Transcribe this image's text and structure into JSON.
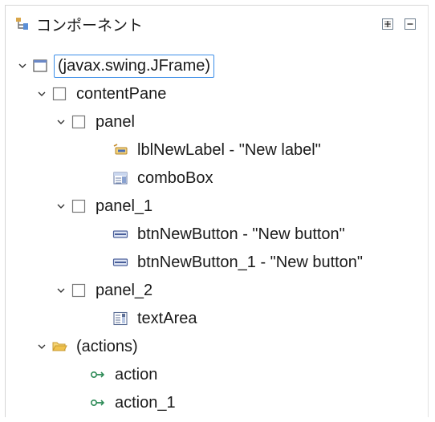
{
  "header": {
    "title": "コンポーネント",
    "icon": "component-tree-icon",
    "expand_all_icon": "expand-all-icon",
    "collapse_all_icon": "collapse-all-icon"
  },
  "tree": {
    "root": {
      "label": "(javax.swing.JFrame)",
      "selected": true
    },
    "contentPane": {
      "label": "contentPane"
    },
    "panel": {
      "label": "panel"
    },
    "lblNewLabel": {
      "label": "lblNewLabel - \"New label\""
    },
    "comboBox": {
      "label": "comboBox"
    },
    "panel_1": {
      "label": "panel_1"
    },
    "btnNewButton": {
      "label": "btnNewButton - \"New button\""
    },
    "btnNewButton_1": {
      "label": "btnNewButton_1 - \"New button\""
    },
    "panel_2": {
      "label": "panel_2"
    },
    "textArea": {
      "label": "textArea"
    },
    "actions": {
      "label": "(actions)"
    },
    "action": {
      "label": "action"
    },
    "action_1": {
      "label": "action_1"
    }
  },
  "colors": {
    "selection_border": "#3c8ee8",
    "folder": "#f0c24c",
    "action_green": "#2e8b57",
    "button_blue": "#4a5f9a"
  }
}
